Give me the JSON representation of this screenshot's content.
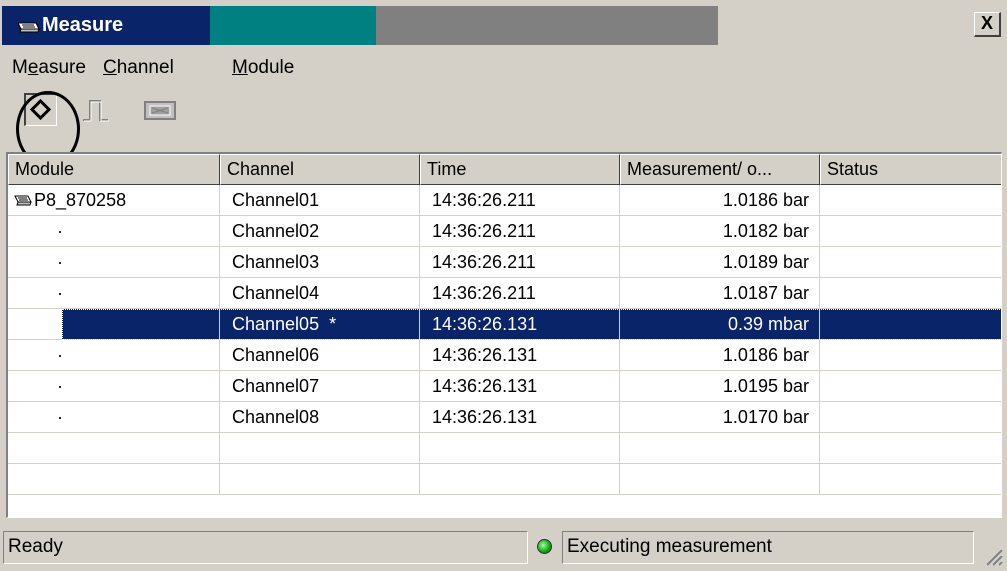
{
  "window": {
    "title": "Measure",
    "close_glyph": "X"
  },
  "menu": {
    "items": [
      {
        "label": "Measure",
        "access": "e"
      },
      {
        "label": "Channel",
        "access": "C"
      },
      {
        "label": "Module",
        "access": "M"
      }
    ]
  },
  "toolbar": {
    "buttons": [
      {
        "name": "start-measure",
        "icon": "diamond-icon",
        "pressed": true
      },
      {
        "name": "pulse",
        "icon": "pulse-icon",
        "pressed": false
      },
      {
        "name": "display",
        "icon": "display-icon",
        "pressed": false
      }
    ]
  },
  "table": {
    "columns": [
      "Module",
      "Channel",
      "Time",
      "Measurement/ o...",
      "Status"
    ],
    "rows": [
      {
        "module": "P8_870258",
        "channel": "Channel01",
        "time": "14:36:26.211",
        "measurement": "1.0186 bar",
        "status": ""
      },
      {
        "module": "·",
        "channel": "Channel02",
        "time": "14:36:26.211",
        "measurement": "1.0182 bar",
        "status": ""
      },
      {
        "module": "·",
        "channel": "Channel03",
        "time": "14:36:26.211",
        "measurement": "1.0189 bar",
        "status": ""
      },
      {
        "module": "·",
        "channel": "Channel04",
        "time": "14:36:26.211",
        "measurement": "1.0187 bar",
        "status": ""
      },
      {
        "module": "",
        "channel": "Channel05  *",
        "time": "14:36:26.131",
        "measurement": "0.39 mbar",
        "status": "",
        "selected": true
      },
      {
        "module": "·",
        "channel": "Channel06",
        "time": "14:36:26.131",
        "measurement": "1.0186 bar",
        "status": ""
      },
      {
        "module": "·",
        "channel": "Channel07",
        "time": "14:36:26.131",
        "measurement": "1.0195 bar",
        "status": ""
      },
      {
        "module": "·",
        "channel": "Channel08",
        "time": "14:36:26.131",
        "measurement": "1.0170 bar",
        "status": ""
      },
      {
        "module": "",
        "channel": "",
        "time": "",
        "measurement": "",
        "status": ""
      },
      {
        "module": "",
        "channel": "",
        "time": "",
        "measurement": "",
        "status": ""
      }
    ]
  },
  "statusbar": {
    "left": "Ready",
    "right": "Executing measurement",
    "indicator_color": "#20c020"
  },
  "colors": {
    "selection": "#0a246a",
    "title_active": "#0a246a",
    "face": "#d4d0c8"
  }
}
